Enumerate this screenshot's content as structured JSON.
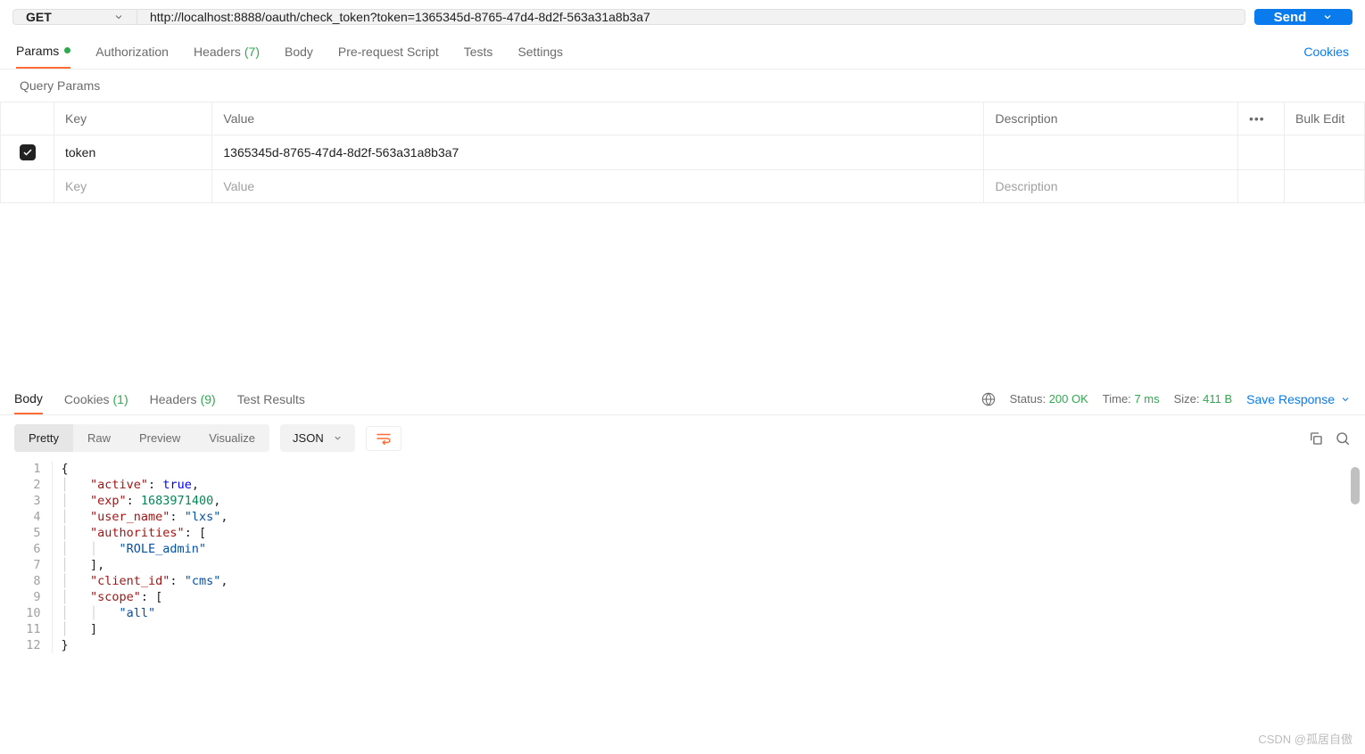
{
  "request": {
    "method": "GET",
    "url": "http://localhost:8888/oauth/check_token?token=1365345d-8765-47d4-8d2f-563a31a8b3a7",
    "send_label": "Send"
  },
  "tabs": {
    "params": "Params",
    "authorization": "Authorization",
    "headers": "Headers",
    "headers_count": "(7)",
    "body": "Body",
    "prerequest": "Pre-request Script",
    "tests": "Tests",
    "settings": "Settings",
    "cookies_link": "Cookies"
  },
  "query_params": {
    "section_label": "Query Params",
    "headers": {
      "key": "Key",
      "value": "Value",
      "description": "Description",
      "bulk": "Bulk Edit"
    },
    "rows": [
      {
        "key": "token",
        "value": "1365345d-8765-47d4-8d2f-563a31a8b3a7"
      }
    ],
    "placeholders": {
      "key": "Key",
      "value": "Value",
      "description": "Description"
    }
  },
  "response": {
    "tabs": {
      "body": "Body",
      "cookies": "Cookies",
      "cookies_count": "(1)",
      "headers": "Headers",
      "headers_count": "(9)",
      "test_results": "Test Results"
    },
    "status_label": "Status:",
    "status_value": "200 OK",
    "time_label": "Time:",
    "time_value": "7 ms",
    "size_label": "Size:",
    "size_value": "411 B",
    "save_response": "Save Response",
    "views": {
      "pretty": "Pretty",
      "raw": "Raw",
      "preview": "Preview",
      "visualize": "Visualize"
    },
    "lang": "JSON",
    "body": {
      "active": true,
      "exp": 1683971400,
      "user_name": "lxs",
      "authorities": [
        "ROLE_admin"
      ],
      "client_id": "cms",
      "scope": [
        "all"
      ]
    },
    "code_lines": [
      [
        {
          "t": "punc",
          "v": "{"
        }
      ],
      [
        {
          "t": "indent",
          "v": 1
        },
        {
          "t": "key",
          "v": "\"active\""
        },
        {
          "t": "punc",
          "v": ": "
        },
        {
          "t": "bool",
          "v": "true"
        },
        {
          "t": "punc",
          "v": ","
        }
      ],
      [
        {
          "t": "indent",
          "v": 1
        },
        {
          "t": "key",
          "v": "\"exp\""
        },
        {
          "t": "punc",
          "v": ": "
        },
        {
          "t": "num",
          "v": "1683971400"
        },
        {
          "t": "punc",
          "v": ","
        }
      ],
      [
        {
          "t": "indent",
          "v": 1
        },
        {
          "t": "key",
          "v": "\"user_name\""
        },
        {
          "t": "punc",
          "v": ": "
        },
        {
          "t": "str",
          "v": "\"lxs\""
        },
        {
          "t": "punc",
          "v": ","
        }
      ],
      [
        {
          "t": "indent",
          "v": 1
        },
        {
          "t": "key",
          "v": "\"authorities\""
        },
        {
          "t": "punc",
          "v": ": ["
        }
      ],
      [
        {
          "t": "indent",
          "v": 2
        },
        {
          "t": "str",
          "v": "\"ROLE_admin\""
        }
      ],
      [
        {
          "t": "indent",
          "v": 1
        },
        {
          "t": "punc",
          "v": "],"
        }
      ],
      [
        {
          "t": "indent",
          "v": 1
        },
        {
          "t": "key",
          "v": "\"client_id\""
        },
        {
          "t": "punc",
          "v": ": "
        },
        {
          "t": "str",
          "v": "\"cms\""
        },
        {
          "t": "punc",
          "v": ","
        }
      ],
      [
        {
          "t": "indent",
          "v": 1
        },
        {
          "t": "key",
          "v": "\"scope\""
        },
        {
          "t": "punc",
          "v": ": ["
        }
      ],
      [
        {
          "t": "indent",
          "v": 2
        },
        {
          "t": "str",
          "v": "\"all\""
        }
      ],
      [
        {
          "t": "indent",
          "v": 1
        },
        {
          "t": "punc",
          "v": "]"
        }
      ],
      [
        {
          "t": "punc",
          "v": "}"
        }
      ]
    ]
  },
  "watermark": "CSDN @孤居自傲"
}
